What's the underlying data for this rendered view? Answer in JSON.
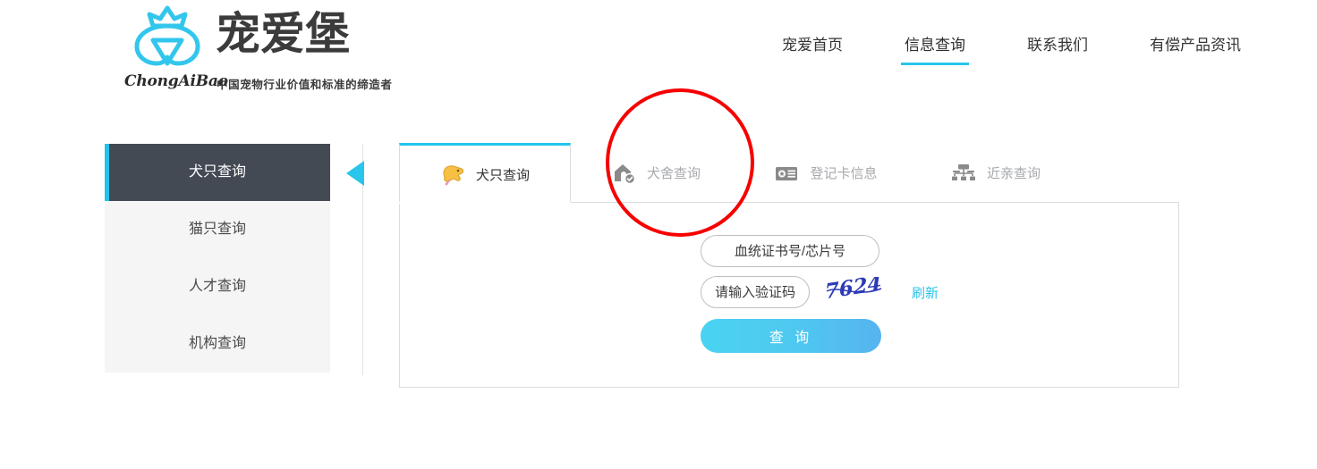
{
  "brand": {
    "wordmark": "宠爱堡",
    "pinyin": "ChongAiBao",
    "tagline": "中国宠物行业价值和标准的缔造者",
    "logo_icon": "pet-crown-logo-icon",
    "accent_color": "#28c7ec"
  },
  "nav": {
    "items": [
      {
        "label": "宠爱首页",
        "active": false
      },
      {
        "label": "信息查询",
        "active": true
      },
      {
        "label": "联系我们",
        "active": false
      },
      {
        "label": "有偿产品资讯",
        "active": false
      }
    ]
  },
  "sidebar": {
    "items": [
      {
        "label": "犬只查询",
        "active": true
      },
      {
        "label": "猫只查询",
        "active": false
      },
      {
        "label": "人才查询",
        "active": false
      },
      {
        "label": "机构查询",
        "active": false
      }
    ],
    "pointer_icon": "left-triangle-pointer-icon",
    "active_bar_color": "#22c3ea",
    "active_bg_color": "#434a54"
  },
  "tabs": [
    {
      "label": "犬只查询",
      "icon": "dog-head-icon",
      "active": true
    },
    {
      "label": "犬舍查询",
      "icon": "kennel-house-icon",
      "active": false
    },
    {
      "label": "登记卡信息",
      "icon": "registration-card-icon",
      "active": false
    },
    {
      "label": "近亲查询",
      "icon": "pedigree-tree-icon",
      "active": false
    }
  ],
  "form": {
    "cert_placeholder": "血统证书号/芯片号",
    "cert_value": "",
    "captcha_placeholder": "请输入验证码",
    "captcha_value": "",
    "captcha_text": "7624",
    "refresh_label": "刷新",
    "submit_label": "查 询",
    "submit_color": "#4ec9f0"
  },
  "annotation": {
    "shape": "circle",
    "color": "#f60000",
    "target": "犬舍查询"
  }
}
